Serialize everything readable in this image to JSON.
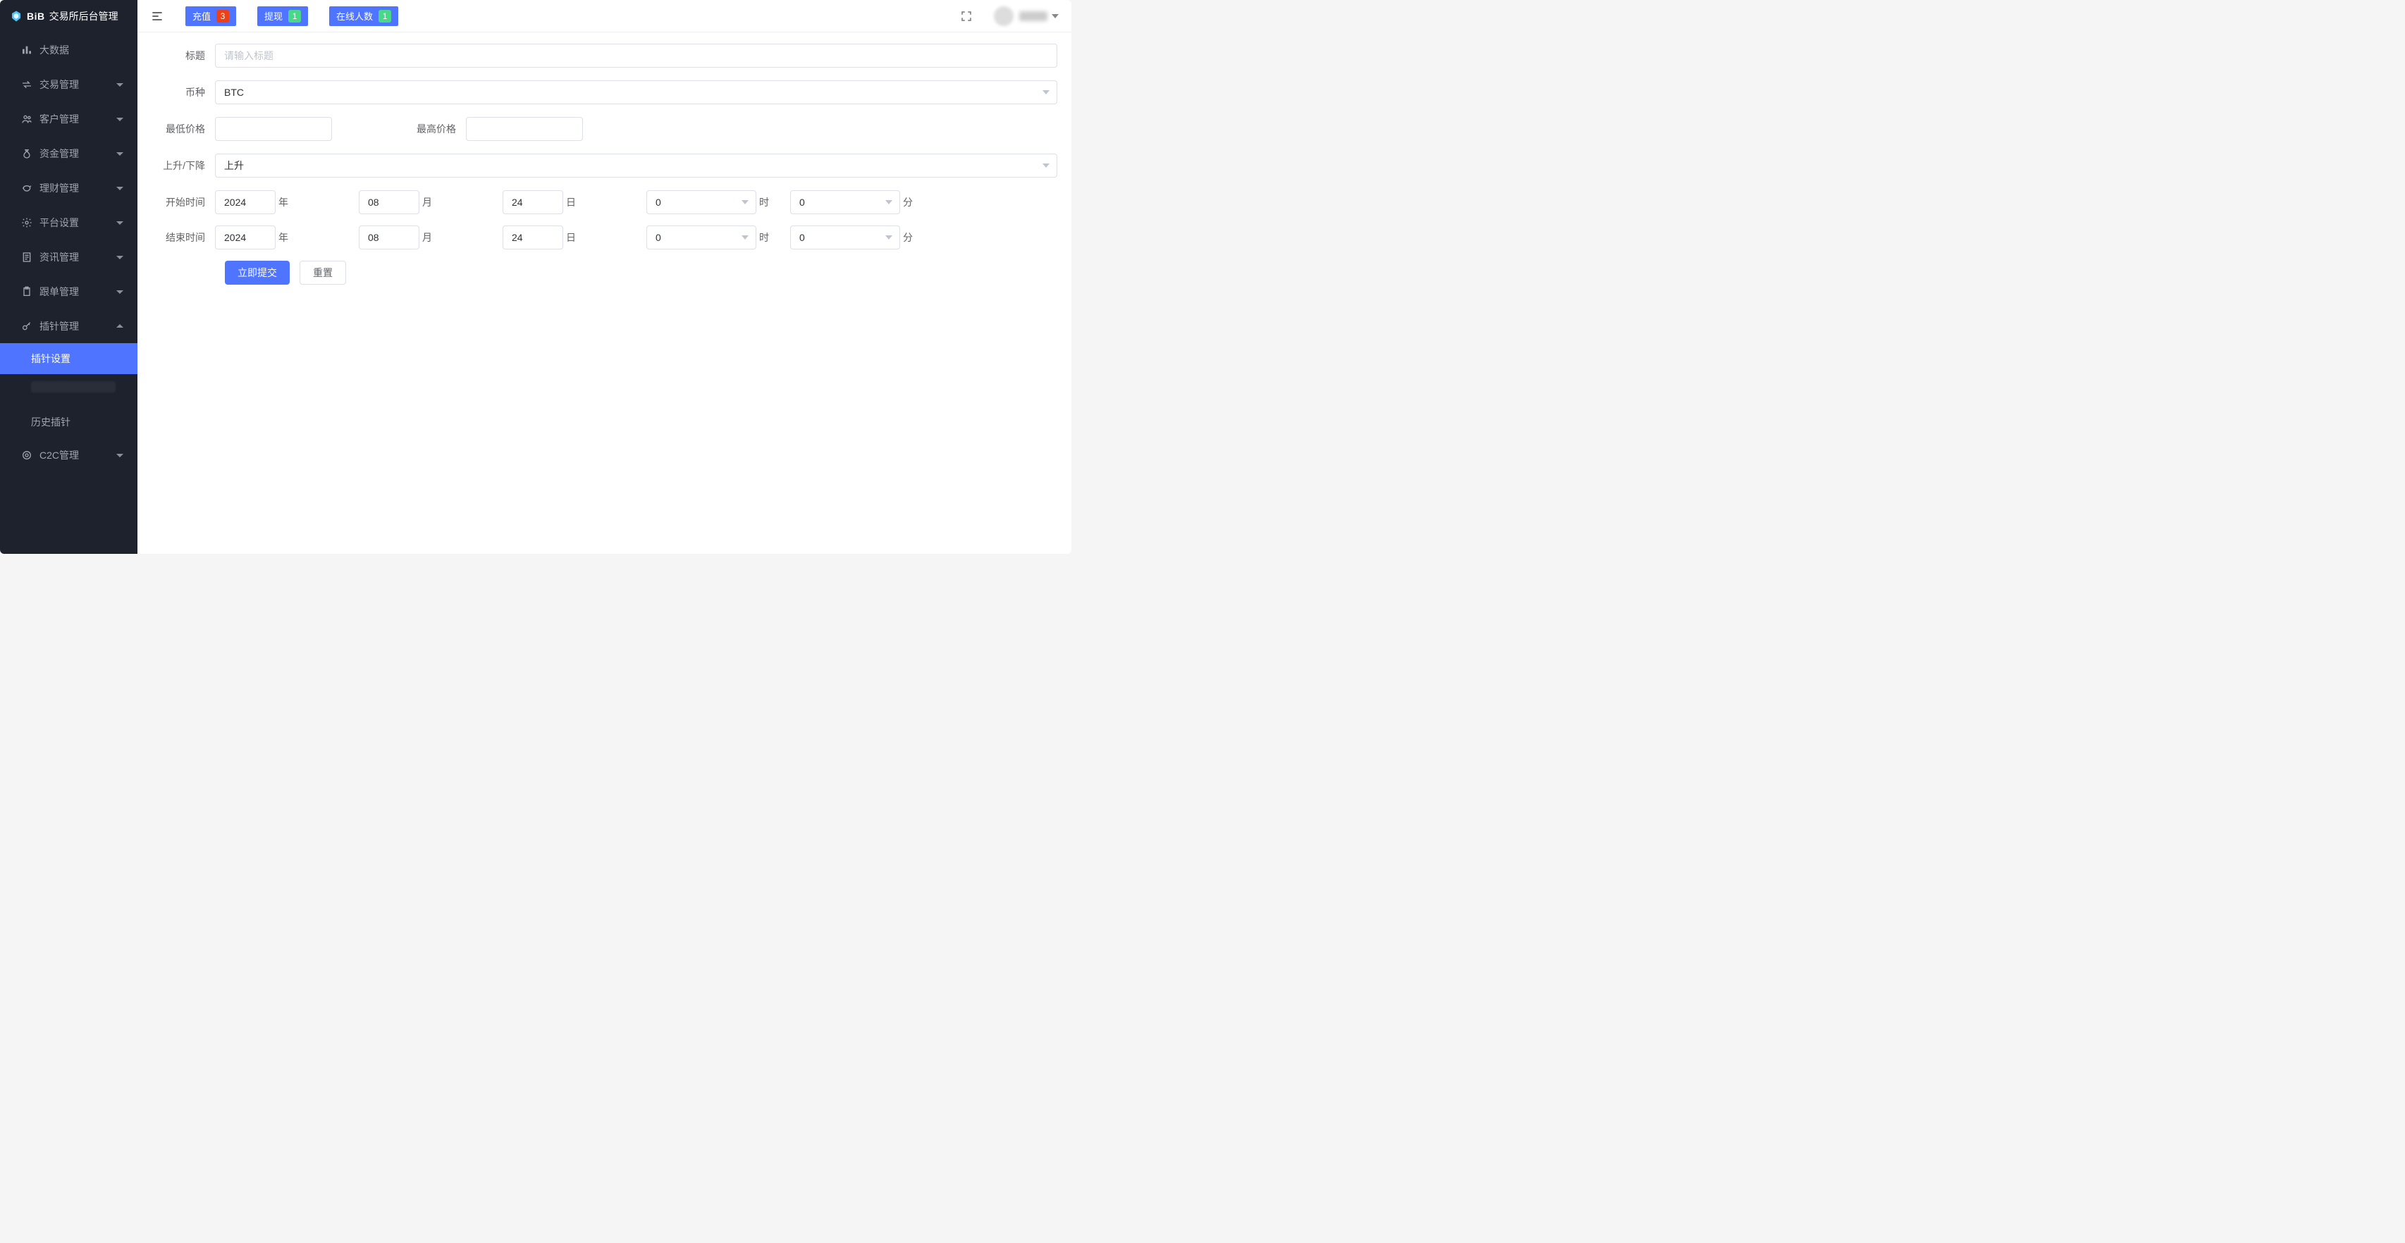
{
  "brand": {
    "name": "BiB",
    "title": "交易所后台管理"
  },
  "sidebar": {
    "items": [
      {
        "label": "大数据",
        "expandable": false
      },
      {
        "label": "交易管理",
        "expandable": true
      },
      {
        "label": "客户管理",
        "expandable": true
      },
      {
        "label": "资金管理",
        "expandable": true
      },
      {
        "label": "理财管理",
        "expandable": true
      },
      {
        "label": "平台设置",
        "expandable": true
      },
      {
        "label": "资讯管理",
        "expandable": true
      },
      {
        "label": "跟单管理",
        "expandable": true
      },
      {
        "label": "插针管理",
        "expandable": true,
        "expanded": true
      },
      {
        "label": "C2C管理",
        "expandable": true
      }
    ],
    "pin_submenu": [
      {
        "label": "插针设置",
        "active": true
      },
      {
        "label": "",
        "redacted": true
      },
      {
        "label": "历史插针",
        "active": false
      }
    ]
  },
  "topbar": {
    "btn_deposit": "充值",
    "badge_deposit": "3",
    "btn_withdraw": "提现",
    "badge_withdraw": "1",
    "btn_online": "在线人数",
    "badge_online": "1"
  },
  "form": {
    "title_label": "标题",
    "title_placeholder": "请输入标题",
    "coin_label": "币种",
    "coin_value": "BTC",
    "min_label": "最低价格",
    "max_label": "最高价格",
    "direction_label": "上升/下降",
    "direction_value": "上升",
    "start_label": "开始时间",
    "end_label": "结束时间",
    "unit_year": "年",
    "unit_month": "月",
    "unit_day": "日",
    "unit_hour": "时",
    "unit_minute": "分",
    "start": {
      "year": "2024",
      "month": "08",
      "day": "24",
      "hour": "0",
      "minute": "0"
    },
    "end": {
      "year": "2024",
      "month": "08",
      "day": "24",
      "hour": "0",
      "minute": "0"
    },
    "submit_label": "立即提交",
    "reset_label": "重置"
  }
}
